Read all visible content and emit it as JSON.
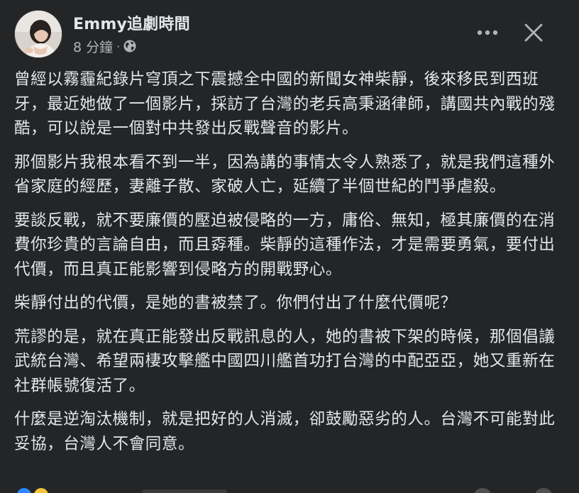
{
  "post": {
    "author": "Emmy追劇時間",
    "time": "8 分鐘",
    "separator": "·",
    "privacy_icon": "globe-icon",
    "more_icon": "more-horizontal-icon",
    "close_icon": "close-icon",
    "paragraphs": [
      "曾經以霧霾紀錄片穹頂之下震撼全中國的新聞女神柴靜，後來移民到西班牙，最近她做了一個影片，採訪了台灣的老兵高秉涵律師，講國共內戰的殘酷，可以說是一個對中共發出反戰聲音的影片。",
      "那個影片我根本看不到一半，因為講的事情太令人熟悉了，就是我們這種外省家庭的經歷，妻離子散、家破人亡，延續了半個世紀的鬥爭虐殺。",
      "要談反戰，就不要廉價的壓迫被侵略的一方，庸俗、無知，極其廉價的在消費你珍貴的言論自由，而且孬種。柴靜的這種作法，才是需要勇氣，要付出代價，而且真正能影響到侵略方的開戰野心。",
      "柴靜付出的代價，是她的書被禁了。你們付出了什麼代價呢？",
      "荒謬的是，就在真正能發出反戰訊息的人，她的書被下架的時候，那個倡議武統台灣、希望兩棲攻擊艦中國四川艦首功打台灣的中配亞亞，她又重新在社群帳號復活了。",
      "什麼是逆淘汰機制，就是把好的人消滅，卻鼓勵惡劣的人。台灣不可能對此妥協，台灣人不會同意。"
    ]
  },
  "colors": {
    "background": "#242526",
    "primary_text": "#e4e6eb",
    "secondary_text": "#b0b3b8"
  }
}
